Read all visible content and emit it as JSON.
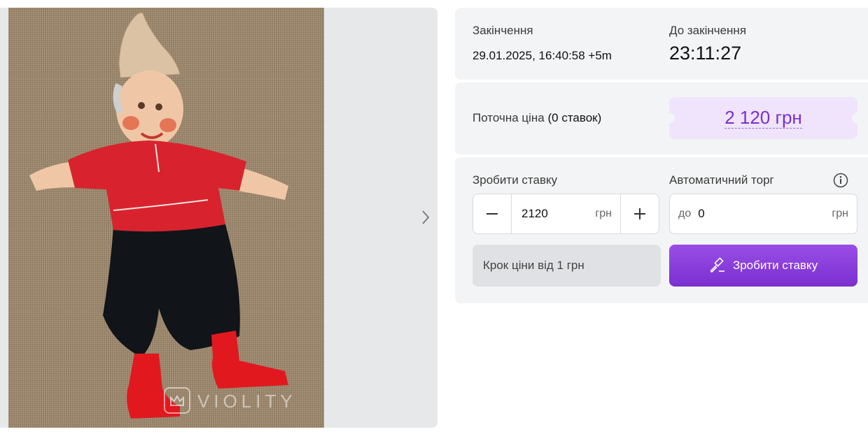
{
  "gallery": {
    "watermark": "VIOLITY",
    "next_icon": "chevron-right-icon"
  },
  "auction": {
    "end_label": "Закінчення",
    "end_value": "29.01.2025, 16:40:58 +5m",
    "time_left_label": "До закінчення",
    "time_left_value": "23:11:27"
  },
  "price": {
    "label": "Поточна ціна",
    "bids_count": "(0 ставок)",
    "value": "2 120 грн"
  },
  "bid": {
    "label": "Зробити ставку",
    "amount": "2120",
    "unit": "грн",
    "minus_icon": "minus-icon",
    "plus_icon": "plus-icon",
    "auto_label": "Автоматичний торг",
    "auto_prefix": "до",
    "auto_value": "0",
    "auto_unit": "грн",
    "info_icon": "info-icon",
    "step_text": "Крок ціни від 1 грн",
    "button_label": "Зробити ставку",
    "button_icon": "gavel-icon"
  },
  "colors": {
    "accent": "#7a2fd0",
    "price_bg": "#efe4fb",
    "panel_bg": "#f3f4f5"
  }
}
